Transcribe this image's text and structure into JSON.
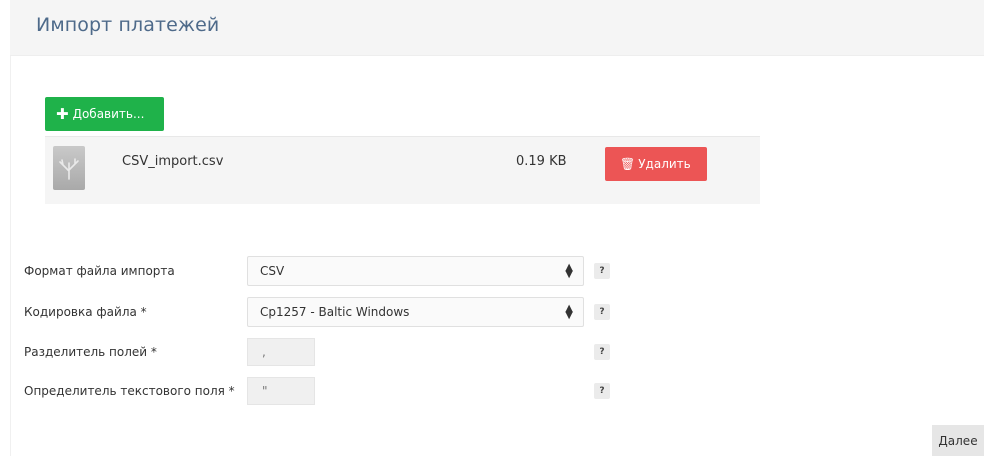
{
  "page": {
    "title": "Импорт платежей"
  },
  "upload": {
    "add_label": "Добавить...",
    "file": {
      "name": "CSV_import.csv",
      "size": "0.19 KB"
    },
    "delete_label": "Удалить"
  },
  "form": {
    "format": {
      "label": "Формат файла импорта",
      "value": "CSV"
    },
    "encoding": {
      "label": "Кодировка файла *",
      "value": "Cp1257 - Baltic Windows"
    },
    "separator": {
      "label": "Разделитель полей *",
      "value": ","
    },
    "text_qualifier": {
      "label": "Определитель текстового поля *",
      "value": "\""
    },
    "help_label": "?"
  },
  "footer": {
    "next_label": "Далее"
  }
}
